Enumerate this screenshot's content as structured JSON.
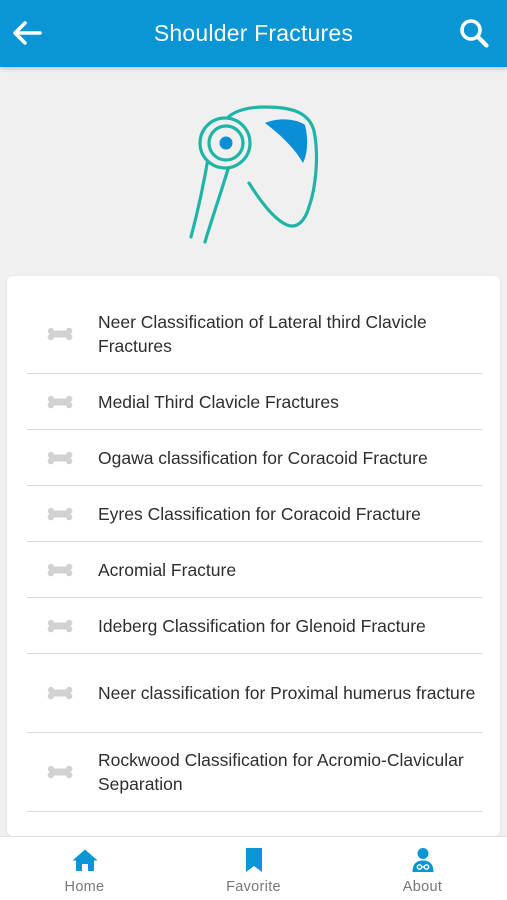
{
  "header": {
    "title": "Shoulder Fractures",
    "back_icon": "arrow-left-icon",
    "search_icon": "search-icon",
    "background_color": "#0a95d4"
  },
  "hero": {
    "icon": "shoulder-joint-icon",
    "stroke_color": "#1fb5a6",
    "accent_color": "#0a8fd6"
  },
  "list": {
    "item_icon": "bone-icon",
    "items": [
      {
        "label": "Neer Classification of Lateral third Clavicle Fractures"
      },
      {
        "label": "Medial Third Clavicle Fractures"
      },
      {
        "label": "Ogawa classification for Coracoid Fracture"
      },
      {
        "label": "Eyres Classification for Coracoid Fracture"
      },
      {
        "label": "Acromial Fracture"
      },
      {
        "label": "Ideberg Classification for Glenoid Fracture"
      },
      {
        "label": "Neer classification for Proximal humerus fracture"
      },
      {
        "label": "Rockwood Classification for Acromio-Clavicular Separation"
      }
    ]
  },
  "bottom_nav": {
    "accent_color": "#0a95d4",
    "items": [
      {
        "label": "Home",
        "icon": "home-icon"
      },
      {
        "label": "Favorite",
        "icon": "bookmark-icon"
      },
      {
        "label": "About",
        "icon": "doctor-icon"
      }
    ]
  }
}
